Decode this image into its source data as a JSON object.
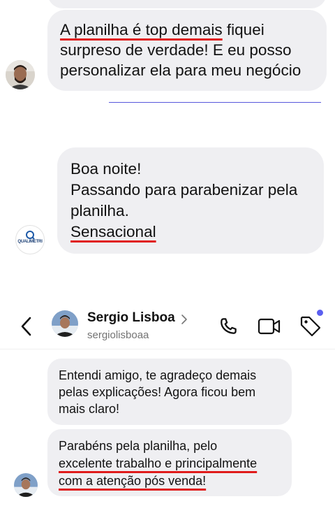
{
  "chat1": {
    "message": {
      "lines": [
        {
          "underlined": "A planilha é top demais",
          "rest": " fiquei"
        },
        {
          "text": "surpreso de verdade! E eu posso"
        },
        {
          "text": "personalizar ela para meu negócio"
        }
      ]
    }
  },
  "chat2": {
    "avatar_text": "QUALIMETRI",
    "message": {
      "lines": [
        {
          "text": "Boa noite!"
        },
        {
          "text": "Passando para parabenizar pela"
        },
        {
          "text": "planilha."
        },
        {
          "underlined": "Sensacional"
        }
      ]
    }
  },
  "header": {
    "name": "Sergio Lisboa",
    "username": "sergiolisboaa",
    "back_icon": "chevron-left-icon",
    "call_icon": "phone-icon",
    "video_icon": "video-camera-icon",
    "tag_icon": "tag-icon",
    "notification_dot_color": "#5b5ff0"
  },
  "chat3": {
    "messages": [
      {
        "lines": [
          {
            "text": "Entendi amigo, te agradeço demais"
          },
          {
            "text": "pelas explicações! Agora ficou bem"
          },
          {
            "text": "mais claro!"
          }
        ]
      },
      {
        "lines": [
          {
            "text": "Parabéns pela planilha, pelo"
          },
          {
            "underlined": "excelente trabalho e principalmente"
          },
          {
            "underlined": "com a atenção pós venda!"
          }
        ]
      }
    ]
  },
  "colors": {
    "bubble": "#efeff2",
    "underline": "#e01b1b",
    "divider": "#3b3bd6"
  }
}
